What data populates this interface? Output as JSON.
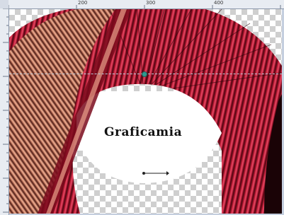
{
  "rulers": {
    "top_labels": [
      "",
      "200",
      "300",
      "400"
    ],
    "left_labels": [
      "",
      "",
      "",
      "",
      "",
      "",
      "",
      ""
    ]
  },
  "canvas": {
    "overlay_text": "Graficamia"
  }
}
